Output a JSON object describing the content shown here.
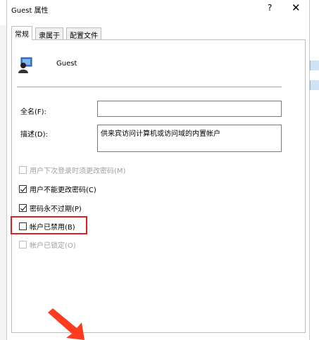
{
  "dialog": {
    "title": "Guest 属性",
    "help_label": "?",
    "close_label": "✕"
  },
  "tabs": [
    {
      "label": "常规",
      "active": true
    },
    {
      "label": "隶属于",
      "active": false
    },
    {
      "label": "配置文件",
      "active": false
    }
  ],
  "user": {
    "name": "Guest",
    "icon": "user-icon"
  },
  "fields": {
    "fullname_label": "全名(F):",
    "fullname_value": "",
    "description_label": "描述(D):",
    "description_value": "供来宾访问计算机或访问域的内置帐户"
  },
  "checkboxes": [
    {
      "label": "用户下次登录时须更改密码(M)",
      "checked": false,
      "enabled": false
    },
    {
      "label": "用户不能更改密码(C)",
      "checked": true,
      "enabled": true
    },
    {
      "label": "密码永不过期(P)",
      "checked": true,
      "enabled": true
    },
    {
      "label": "帐户已禁用(B)",
      "checked": false,
      "enabled": true
    },
    {
      "label": "帐户已锁定(O)",
      "checked": false,
      "enabled": false
    }
  ],
  "annotation": {
    "highlight_color": "#e02020",
    "arrow_color": "#ff3b1f"
  }
}
